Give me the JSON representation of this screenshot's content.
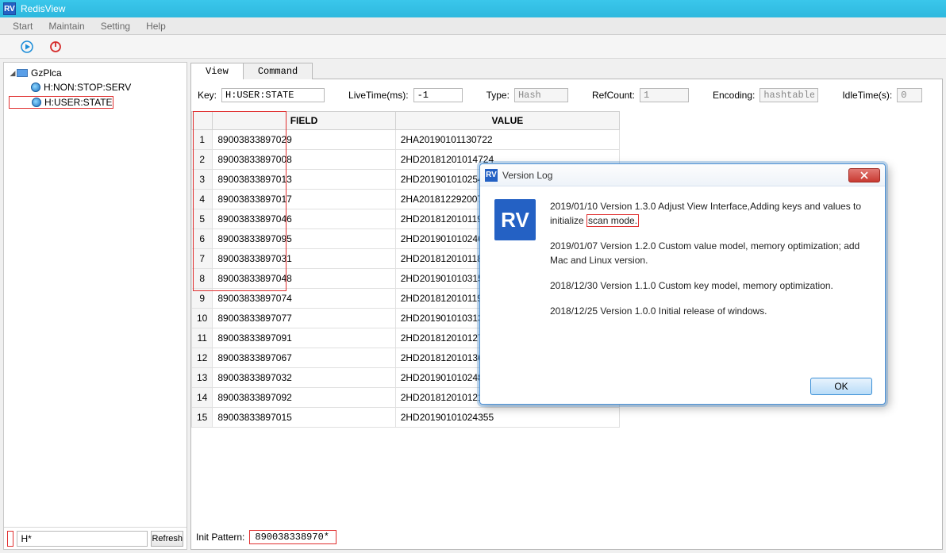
{
  "app": {
    "title": "RedisView",
    "icon_text": "RV"
  },
  "menu": {
    "items": [
      "Start",
      "Maintain",
      "Setting",
      "Help"
    ]
  },
  "tree": {
    "root": "GzPlca",
    "keys": [
      "H:NON:STOP:SERV",
      "H:USER:STATE"
    ]
  },
  "sidebar": {
    "pattern_value": "H*",
    "refresh_label": "Refresh"
  },
  "tabs": {
    "view": "View",
    "command": "Command"
  },
  "props": {
    "key_label": "Key:",
    "key_value": "H:USER:STATE",
    "live_label": "LiveTime(ms):",
    "live_value": "-1",
    "type_label": "Type:",
    "type_value": "Hash",
    "refcount_label": "RefCount:",
    "refcount_value": "1",
    "encoding_label": "Encoding:",
    "encoding_value": "hashtable",
    "idle_label": "IdleTime(s):",
    "idle_value": "0"
  },
  "table": {
    "headers": [
      "",
      "FIELD",
      "VALUE"
    ],
    "rows": [
      [
        "1",
        "89003833897029",
        "2HA20190101130722"
      ],
      [
        "2",
        "89003833897008",
        "2HD20181201014724"
      ],
      [
        "3",
        "89003833897013",
        "2HD20190101025420"
      ],
      [
        "4",
        "89003833897017",
        "2HA20181229200724"
      ],
      [
        "5",
        "89003833897046",
        "2HD20181201011945"
      ],
      [
        "6",
        "89003833897095",
        "2HD20190101024625"
      ],
      [
        "7",
        "89003833897031",
        "2HD20181201011830"
      ],
      [
        "8",
        "89003833897048",
        "2HD20190101031553"
      ],
      [
        "9",
        "89003833897074",
        "2HD20181201011958"
      ],
      [
        "10",
        "89003833897077",
        "2HD20190101031338"
      ],
      [
        "11",
        "89003833897091",
        "2HD20181201012702"
      ],
      [
        "12",
        "89003833897067",
        "2HD20181201013622"
      ],
      [
        "13",
        "89003833897032",
        "2HD20190101024824"
      ],
      [
        "14",
        "89003833897092",
        "2HD20181201012106"
      ],
      [
        "15",
        "89003833897015",
        "2HD20190101024355"
      ]
    ]
  },
  "init": {
    "label": "Init Pattern:",
    "value": "890038338970*"
  },
  "dialog": {
    "title": "Version Log",
    "entries": [
      {
        "prefix": "2019/01/10  Version 1.3.0  Adjust View Interface,Adding keys and values to initialize ",
        "highlight": "scan mode.",
        "suffix": ""
      },
      {
        "prefix": "2019/01/07  Version 1.2.0  Custom value model, memory optimization; add Mac and Linux version.",
        "highlight": "",
        "suffix": ""
      },
      {
        "prefix": "2018/12/30  Version 1.1.0  Custom key model, memory optimization.",
        "highlight": "",
        "suffix": ""
      },
      {
        "prefix": "2018/12/25  Version 1.0.0  Initial release of windows.",
        "highlight": "",
        "suffix": ""
      }
    ],
    "ok_label": "OK"
  }
}
